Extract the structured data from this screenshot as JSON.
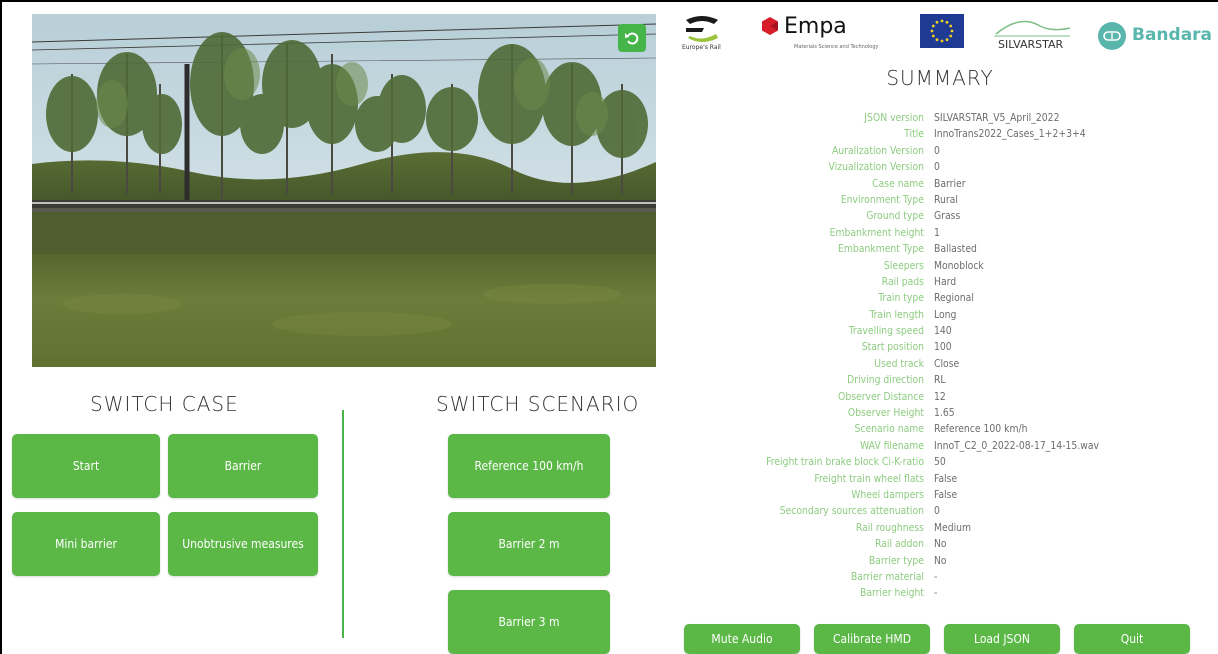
{
  "header": {
    "logos": {
      "europes_rail": "Europe's Rail",
      "empa_name": "Empa",
      "empa_tagline": "Materials Science and Technology",
      "silvarstar": "SILVARSTAR",
      "bandara": "Bandara"
    }
  },
  "left": {
    "switch_case_title": "SWITCH CASE",
    "switch_scenario_title": "SWITCH SCENARIO",
    "cases": [
      "Start",
      "Barrier",
      "Mini barrier",
      "Unobtrusive measures"
    ],
    "scenarios": [
      "Reference 100 km/h",
      "Barrier 2 m",
      "Barrier 3 m"
    ]
  },
  "summary": {
    "title": "SUMMARY",
    "rows": [
      {
        "k": "JSON version",
        "v": "SILVARSTAR_V5_April_2022"
      },
      {
        "k": "Title",
        "v": "InnoTrans2022_Cases_1+2+3+4"
      },
      {
        "k": "Auralization Version",
        "v": "0"
      },
      {
        "k": "Vizualization Version",
        "v": "0"
      },
      {
        "k": "Case name",
        "v": "Barrier"
      },
      {
        "k": "Environment Type",
        "v": "Rural"
      },
      {
        "k": "Ground type",
        "v": "Grass"
      },
      {
        "k": "Embankment height",
        "v": "1"
      },
      {
        "k": "Embankment Type",
        "v": "Ballasted"
      },
      {
        "k": "Sleepers",
        "v": "Monoblock"
      },
      {
        "k": "Rail pads",
        "v": "Hard"
      },
      {
        "k": "Train type",
        "v": "Regional"
      },
      {
        "k": "Train length",
        "v": "Long"
      },
      {
        "k": "Travelling speed",
        "v": "140"
      },
      {
        "k": "Start position",
        "v": "100"
      },
      {
        "k": "Used track",
        "v": "Close"
      },
      {
        "k": "Driving direction",
        "v": "RL"
      },
      {
        "k": "Observer Distance",
        "v": "12"
      },
      {
        "k": "Observer Height",
        "v": "1.65"
      },
      {
        "k": "Scenario name",
        "v": "Reference 100 km/h"
      },
      {
        "k": "WAV filename",
        "v": "InnoT_C2_0_2022-08-17_14-15.wav"
      },
      {
        "k": "Freight train brake block Ci-K-ratio",
        "v": "50"
      },
      {
        "k": "Freight train wheel flats",
        "v": "False"
      },
      {
        "k": "Wheel dampers",
        "v": "False"
      },
      {
        "k": "Secondary sources attenuation",
        "v": "0"
      },
      {
        "k": "Rail roughness",
        "v": "Medium"
      },
      {
        "k": "Rail addon",
        "v": "No"
      },
      {
        "k": "Barrier type",
        "v": "No"
      },
      {
        "k": "Barrier material",
        "v": "-"
      },
      {
        "k": "Barrier height",
        "v": "-"
      }
    ]
  },
  "footer": {
    "mute": "Mute Audio",
    "calibrate": "Calibrate HMD",
    "load": "Load JSON",
    "quit": "Quit"
  },
  "colors": {
    "accent": "#5bb846",
    "label": "#8dcc80",
    "value": "#6d6d6d"
  }
}
